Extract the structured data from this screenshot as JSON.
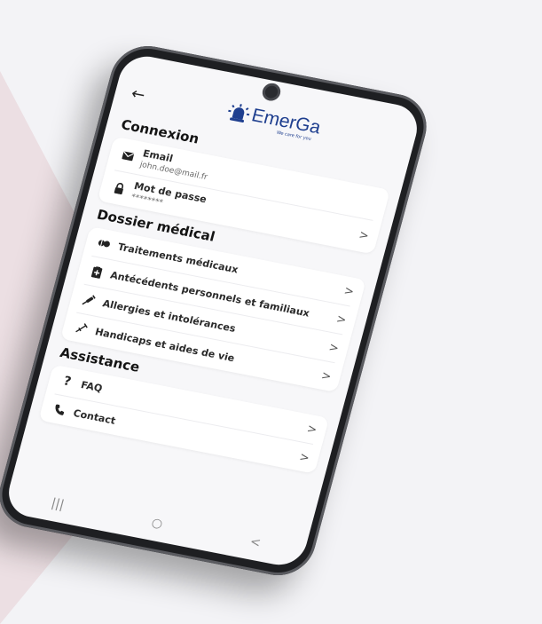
{
  "app": {
    "logo_text": "EmerGa",
    "tagline": "We care for you",
    "brand_color": "#1f3f8f"
  },
  "nav": {
    "back_icon": "arrow-left-icon"
  },
  "sections": {
    "connexion": {
      "title": "Connexion",
      "email": {
        "label": "Email",
        "value": "john.doe@mail.fr"
      },
      "password": {
        "label": "Mot de passe",
        "value": "********"
      }
    },
    "dossier": {
      "title": "Dossier médical",
      "items": [
        {
          "label": "Traitements médicaux"
        },
        {
          "label": "Antécédents personnels et familiaux"
        },
        {
          "label": "Allergies et intolérances"
        },
        {
          "label": "Handicaps et aides de vie"
        }
      ]
    },
    "assistance": {
      "title": "Assistance",
      "items": [
        {
          "label": "FAQ"
        },
        {
          "label": "Contact"
        }
      ]
    }
  },
  "chevron": ">",
  "system_nav": {
    "recents": "|||",
    "home": "○",
    "back": "<"
  },
  "colors": {
    "background": "#f3f3f6",
    "accent_triangle": "#ecdfe3",
    "card": "#ffffff"
  }
}
